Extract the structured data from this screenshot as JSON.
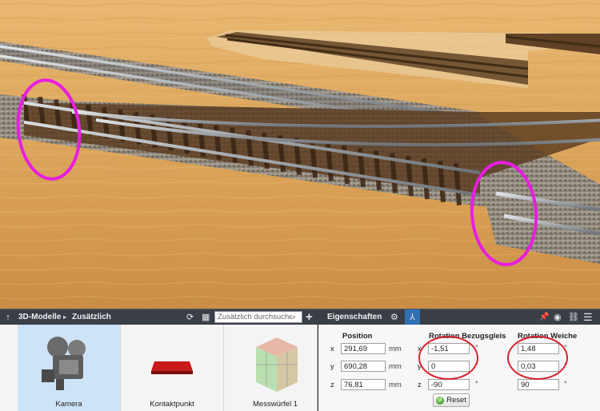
{
  "toolbar": {
    "breadcrumb_root": "3D-Modelle",
    "breadcrumb_child": "Zusätzlich",
    "search_placeholder": "Zusätzlich durchsuchen",
    "properties_title": "Eigenschaften"
  },
  "models": [
    {
      "label": "Kamera",
      "icon": "camera-model-icon",
      "selected": true
    },
    {
      "label": "Kontaktpunkt",
      "icon": "contact-point-model-icon",
      "selected": false
    },
    {
      "label": "Messwürfel 1",
      "icon": "measuring-cube-model-icon",
      "selected": false
    }
  ],
  "properties": {
    "position": {
      "heading": "Position",
      "x_label": "x",
      "y_label": "y",
      "z_label": "z",
      "x": "291,69",
      "y": "690,28",
      "z": "76,81",
      "unit": "mm"
    },
    "rotation_track": {
      "heading": "Rotation Bezugsgleis",
      "x_label": "x",
      "y_label": "y",
      "z_label": "z",
      "x": "-1,51",
      "y": "0",
      "z": "-90",
      "unit": "°"
    },
    "rotation_switch": {
      "heading": "Rotation Weiche",
      "x": "1,48",
      "y": "0,03",
      "z": "90",
      "unit": "°"
    },
    "reset_label": "Reset"
  },
  "colors": {
    "highlight_ellipse": "#e81ee0",
    "annotation_circle": "#d8232e",
    "selection": "#cde3f7",
    "toolbar": "#3a3f47"
  }
}
